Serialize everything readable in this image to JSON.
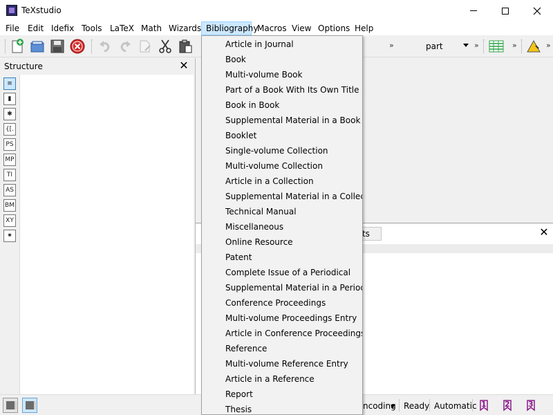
{
  "window": {
    "title": "TeXstudio",
    "minimize": "—",
    "maximize": "☐",
    "close": "✕"
  },
  "menubar": {
    "items": [
      {
        "label": "File"
      },
      {
        "label": "Edit"
      },
      {
        "label": "Idefix"
      },
      {
        "label": "Tools"
      },
      {
        "label": "LaTeX"
      },
      {
        "label": "Math"
      },
      {
        "label": "Wizards"
      },
      {
        "label": "Bibliography"
      },
      {
        "label": "Macros"
      },
      {
        "label": "View"
      },
      {
        "label": "Options"
      },
      {
        "label": "Help"
      }
    ],
    "active": "Bibliography"
  },
  "toolbar": {
    "icons": [
      "new-document-icon",
      "open-icon",
      "save-icon",
      "close-document-icon",
      "undo-icon",
      "redo-icon",
      "copy-icon",
      "cut-icon",
      "paste-icon",
      "table-icon",
      "warning-icon"
    ],
    "more": "»",
    "section_combo": "part"
  },
  "structure": {
    "title": "Structure",
    "close": "✕",
    "side_icons": [
      {
        "label": "≡",
        "icon": "structure-tree-icon"
      },
      {
        "label": "▮",
        "icon": "bookmarks-icon"
      },
      {
        "label": "✱",
        "icon": "symbols-icon"
      },
      {
        "label": "{[.",
        "icon": "brackets-icon"
      },
      {
        "label": "PS",
        "icon": "pstricks-icon"
      },
      {
        "label": "MP",
        "icon": "metapost-icon"
      },
      {
        "label": "TI",
        "icon": "tikz-icon"
      },
      {
        "label": "AS",
        "icon": "asymptote-icon"
      },
      {
        "label": "BM",
        "icon": "beamer-icon"
      },
      {
        "label": "XY",
        "icon": "xymatrix-icon"
      },
      {
        "label": "✷",
        "icon": "special-symbols-icon"
      }
    ]
  },
  "messages": {
    "results_tab": "ults",
    "close": "✕"
  },
  "bibliography_menu": {
    "items": [
      "Article in Journal",
      "Book",
      "Multi-volume Book",
      "Part of a Book With Its Own Title",
      "Book in Book",
      "Supplemental Material in a Book",
      "Booklet",
      "Single-volume Collection",
      "Multi-volume Collection",
      "Article in a Collection",
      "Supplemental Material in a Collection",
      "Technical Manual",
      "Miscellaneous",
      "Online Resource",
      "Patent",
      "Complete Issue of a Periodical",
      "Supplemental Material in a Periodical",
      "Conference Proceedings",
      "Multi-volume Proceedings Entry",
      "Article in Conference Proceedings",
      "Reference",
      "Multi-volume Reference Entry",
      "Article in a Reference",
      "Report",
      "Thesis"
    ]
  },
  "statusbar": {
    "encoding": "ncoding",
    "status": "Ready",
    "language": "Automatic",
    "bookmarks": [
      "1",
      "2",
      "3"
    ]
  },
  "colors": {
    "menu_active_bg": "#cce8ff",
    "menu_active_border": "#99d1ff",
    "bookmark_color": "#8b1a8b",
    "close_red": "#d42a2a"
  }
}
